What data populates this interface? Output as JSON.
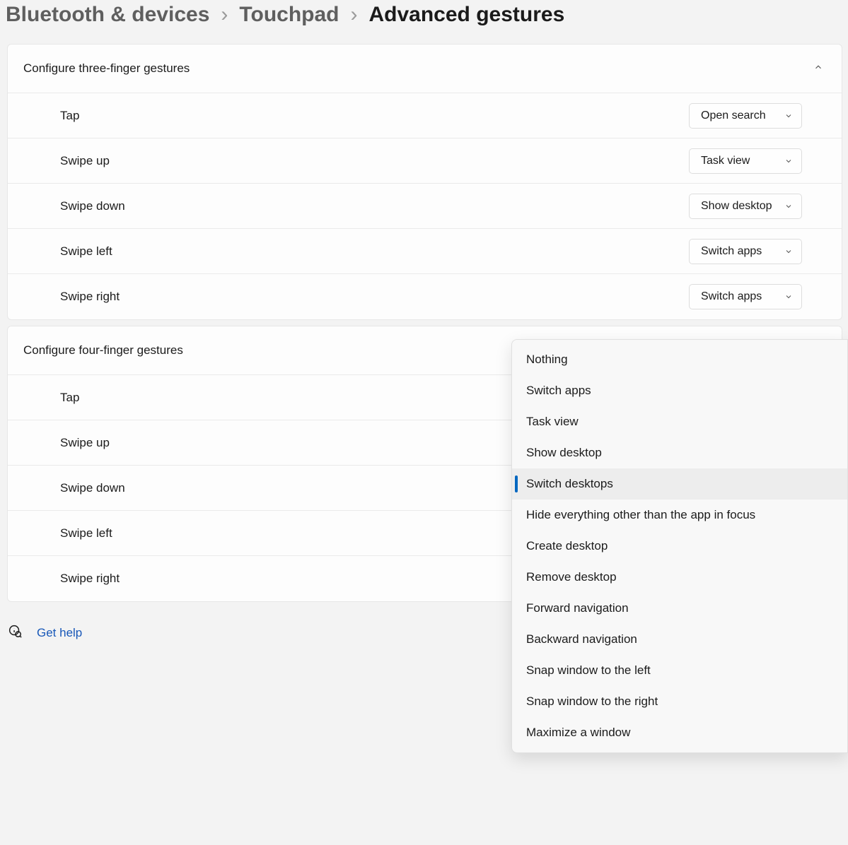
{
  "breadcrumb": {
    "items": [
      {
        "label": "Bluetooth & devices",
        "current": false
      },
      {
        "label": "Touchpad",
        "current": false
      },
      {
        "label": "Advanced gestures",
        "current": true
      }
    ]
  },
  "sections": [
    {
      "title": "Configure three-finger gestures",
      "expanded": true,
      "rows": [
        {
          "label": "Tap",
          "value": "Open search"
        },
        {
          "label": "Swipe up",
          "value": "Task view"
        },
        {
          "label": "Swipe down",
          "value": "Show desktop"
        },
        {
          "label": "Swipe left",
          "value": "Switch apps"
        },
        {
          "label": "Swipe right",
          "value": "Switch apps"
        }
      ]
    },
    {
      "title": "Configure four-finger gestures",
      "expanded": true,
      "rows": [
        {
          "label": "Tap"
        },
        {
          "label": "Swipe up"
        },
        {
          "label": "Swipe down"
        },
        {
          "label": "Swipe left"
        },
        {
          "label": "Swipe right"
        }
      ]
    }
  ],
  "help": {
    "label": "Get help"
  },
  "menu": {
    "options": [
      "Nothing",
      "Switch apps",
      "Task view",
      "Show desktop",
      "Switch desktops",
      "Hide everything other than the app in focus",
      "Create desktop",
      "Remove desktop",
      "Forward navigation",
      "Backward navigation",
      "Snap window to the left",
      "Snap window to the right",
      "Maximize a window"
    ],
    "selected_index": 4
  }
}
